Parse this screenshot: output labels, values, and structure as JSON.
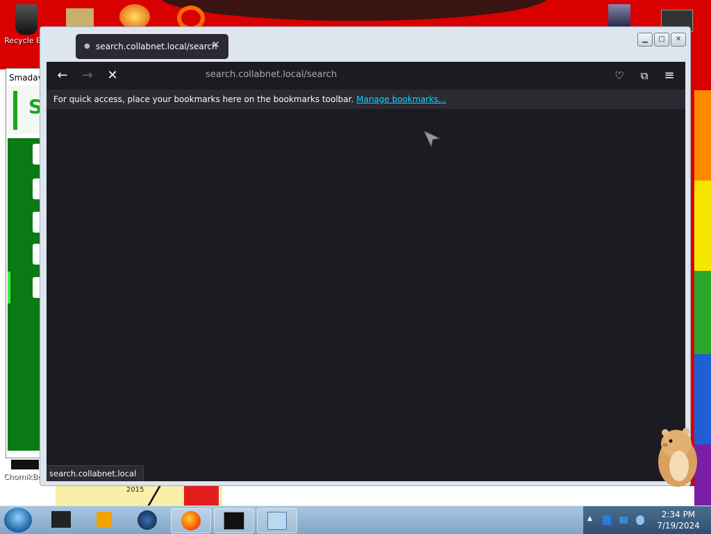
{
  "desktop": {
    "icons": [
      {
        "label": "Recycle Bin"
      },
      {
        "label": "ChomikBox"
      }
    ],
    "partial_label": "2015"
  },
  "background_app": {
    "title": "Smadav"
  },
  "browser": {
    "tab": {
      "title": "search.collabnet.local/search"
    },
    "url": "search.collabnet.local/search",
    "bookmarks_message": "For quick access, place your bookmarks here on the bookmarks toolbar.",
    "bookmarks_link": "Manage bookmarks...",
    "status_text": "search.collabnet.local",
    "loading": true
  },
  "taskbar": {
    "time": "2:34 PM",
    "date": "7/19/2024",
    "items": [
      "terminal",
      "media-player",
      "network",
      "firefox",
      "console",
      "notepad"
    ],
    "active_item": "firefox"
  },
  "colors": {
    "browser_dark": "#1c1b22",
    "browser_chrome": "#2b2a33",
    "link": "#00ddff",
    "wallpaper_red": "#d80000"
  }
}
